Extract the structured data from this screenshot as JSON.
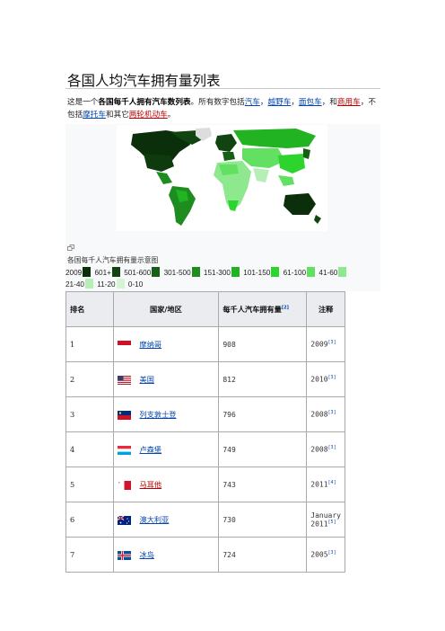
{
  "title": "各国人均汽车拥有量列表",
  "intro": {
    "prefix": "这是一个",
    "bold": "各国每千人拥有汽车数列表",
    "middle": "。所有数字包括",
    "link1": "汽车",
    "sep1": "，",
    "link2": "越野车",
    "sep2": "，",
    "link3": "面包车",
    "sep3": "，和",
    "link4": "商用车",
    "sep4": "，不包括",
    "link5": "摩托车",
    "mid2": "和其它",
    "link6": "两轮机动车",
    "end": "。"
  },
  "figure": {
    "caption": "各国每千人汽车拥有量示意图",
    "legend": [
      {
        "label": "2009",
        "color": "#0b2e0b"
      },
      {
        "label": "601+",
        "color": "#114411"
      },
      {
        "label": "501-600",
        "color": "#166016"
      },
      {
        "label": "301-500",
        "color": "#1e8c1e"
      },
      {
        "label": "151-300",
        "color": "#22b322"
      },
      {
        "label": "101-150",
        "color": "#2ed42e"
      },
      {
        "label": "61-100",
        "color": "#62e062"
      },
      {
        "label": "41-60",
        "color": "#8ee88e"
      },
      {
        "label": "21-40",
        "color": "#b6efb6"
      },
      {
        "label": "11-20",
        "color": "#d4f5d4"
      },
      {
        "label": "0-10",
        "color": ""
      }
    ]
  },
  "table": {
    "headers": {
      "rank": "排名",
      "country": "国家/地区",
      "rate": "每千人汽车拥有量",
      "rate_ref": "[2]",
      "note": "注释"
    },
    "rows": [
      {
        "rank": "1",
        "country": "摩纳哥",
        "value": "908",
        "note": "2009",
        "ref": "[3]",
        "link": "blue",
        "flag": "monaco"
      },
      {
        "rank": "2",
        "country": "美国",
        "value": "812",
        "note": "2010",
        "ref": "[3]",
        "link": "blue",
        "flag": "usa"
      },
      {
        "rank": "3",
        "country": "列支敦士登",
        "value": "796",
        "note": "2008",
        "ref": "[3]",
        "link": "blue",
        "flag": "liechtenstein"
      },
      {
        "rank": "4",
        "country": "卢森堡",
        "value": "749",
        "note": "2008",
        "ref": "[3]",
        "link": "blue",
        "flag": "luxembourg"
      },
      {
        "rank": "5",
        "country": "马耳他",
        "value": "743",
        "note": "2011",
        "ref": "[4]",
        "link": "red",
        "flag": "malta"
      },
      {
        "rank": "6",
        "country": "澳大利亚",
        "value": "730",
        "note": "January 2011",
        "ref": "[5]",
        "link": "blue",
        "flag": "australia"
      },
      {
        "rank": "7",
        "country": "冰岛",
        "value": "724",
        "note": "2005",
        "ref": "[3]",
        "link": "blue",
        "flag": "iceland"
      }
    ]
  }
}
